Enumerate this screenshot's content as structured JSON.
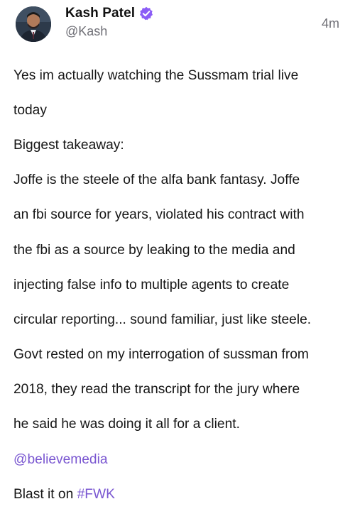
{
  "author": {
    "display_name": "Kash Patel",
    "handle": "@Kash",
    "verified": true,
    "avatar_icon": "user-avatar"
  },
  "post": {
    "time_ago": "4m",
    "lines": [
      "Yes im actually watching the Sussmam trial live",
      "today",
      "Biggest takeaway:",
      "Joffe is the steele of the alfa bank fantasy. Joffe",
      "an fbi source for years, violated his contract with",
      "the fbi as a source by leaking to the media and",
      "injecting false info to multiple agents to create",
      "circular reporting... sound familiar, just like steele.",
      "Govt rested on my interrogation of sussman from",
      "2018, they read the transcript for the jury where",
      "he said he was doing it all for a client."
    ],
    "mention": "@believemedia",
    "closing_prefix": "Blast it on ",
    "hashtag": "#FWK"
  },
  "colors": {
    "link": "#7a57d1",
    "verified_badge": "#8b5cf6",
    "secondary_text": "#6f6f76"
  }
}
